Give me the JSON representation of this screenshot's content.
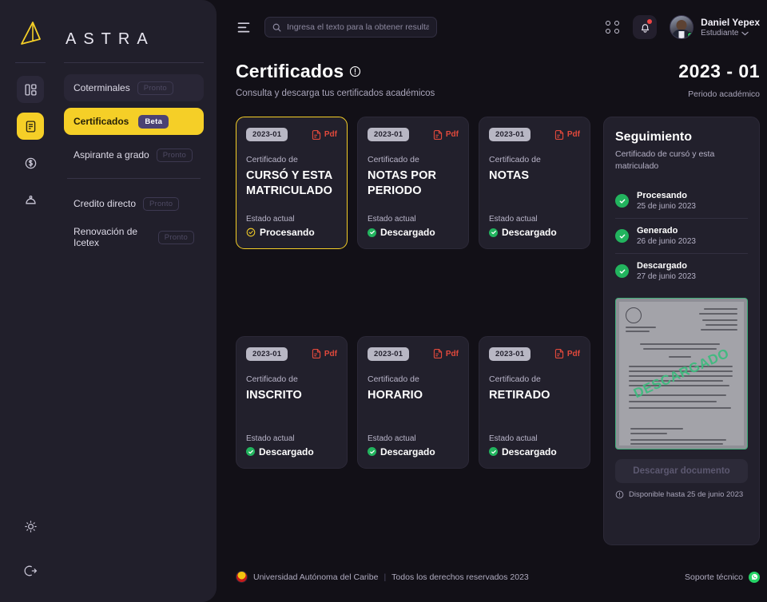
{
  "brand": {
    "word": "ASTRA",
    "logo_icon": "astra-triangle-logo"
  },
  "rail": {
    "items": [
      {
        "icon": "dashboard-layout-icon",
        "state": "panel"
      },
      {
        "icon": "document-certificate-icon",
        "state": "active"
      },
      {
        "icon": "dollar-coin-icon",
        "state": "idle"
      },
      {
        "icon": "graduation-cap-icon",
        "state": "idle"
      }
    ],
    "bottom": [
      {
        "icon": "sun-theme-icon"
      },
      {
        "icon": "logout-icon"
      }
    ]
  },
  "sidebar": {
    "items": [
      {
        "label": "Coterminales",
        "badge": "Pronto",
        "badge_type": "soon",
        "style": "soft"
      },
      {
        "label": "Certificados",
        "badge": "Beta",
        "badge_type": "beta",
        "style": "active"
      },
      {
        "label": "Aspirante a grado",
        "badge": "Pronto",
        "badge_type": "soon",
        "style": "plain"
      },
      {
        "label": "Credito directo",
        "badge": "Pronto",
        "badge_type": "soon",
        "style": "plain"
      },
      {
        "label": "Renovación de Icetex",
        "badge": "Pronto",
        "badge_type": "soon",
        "style": "plain"
      }
    ]
  },
  "topbar": {
    "menu_icon": "hamburger-menu-icon",
    "search": {
      "placeholder": "Ingresa el texto para la obtener resultados",
      "value": "",
      "icon": "search-icon"
    },
    "apps_icon": "grid-apps-icon",
    "bell_icon": "notification-bell-icon",
    "user": {
      "name": "Daniel Yepex",
      "role": "Estudiante",
      "chevron": "chevron-down-icon",
      "avatar": "user-avatar"
    }
  },
  "page": {
    "title": "Certificados",
    "title_info_icon": "info-circle-icon",
    "subtitle": "Consulta y descarga tus certificados académicos",
    "period_value": "2023 - 01",
    "period_label": "Periodo académico"
  },
  "cards": [
    {
      "period": "2023-01",
      "format": "Pdf",
      "kicker": "Certificado de",
      "name": "CURSÓ Y ESTA MATRICULADO",
      "state_label": "Estado actual",
      "state": "Procesando",
      "state_type": "pending",
      "selected": true
    },
    {
      "period": "2023-01",
      "format": "Pdf",
      "kicker": "Certificado de",
      "name": "NOTAS POR PERIODO",
      "state_label": "Estado actual",
      "state": "Descargado",
      "state_type": "ok",
      "selected": false
    },
    {
      "period": "2023-01",
      "format": "Pdf",
      "kicker": "Certificado de",
      "name": "NOTAS",
      "state_label": "Estado actual",
      "state": "Descargado",
      "state_type": "ok",
      "selected": false
    },
    {
      "period": "2023-01",
      "format": "Pdf",
      "kicker": "Certificado de",
      "name": "INSCRITO",
      "state_label": "Estado actual",
      "state": "Descargado",
      "state_type": "ok",
      "selected": false
    },
    {
      "period": "2023-01",
      "format": "Pdf",
      "kicker": "Certificado de",
      "name": "HORARIO",
      "state_label": "Estado actual",
      "state": "Descargado",
      "state_type": "ok",
      "selected": false
    },
    {
      "period": "2023-01",
      "format": "Pdf",
      "kicker": "Certificado de",
      "name": "RETIRADO",
      "state_label": "Estado actual",
      "state": "Descargado",
      "state_type": "ok",
      "selected": false
    }
  ],
  "tracking": {
    "title": "Seguimiento",
    "subtitle": "Certificado de cursó y esta matriculado",
    "steps": [
      {
        "name": "Procesando",
        "date": "25 de junio 2023",
        "icon": "check-circle-icon"
      },
      {
        "name": "Generado",
        "date": "26 de junio 2023",
        "icon": "check-circle-icon"
      },
      {
        "name": "Descargado",
        "date": "27 de junio 2023",
        "icon": "check-circle-icon"
      }
    ],
    "preview_stamp": "DESCARGADO",
    "download_label": "Descargar documento",
    "availability_icon": "info-circle-icon",
    "availability": "Disponible hasta 25 de junio 2023"
  },
  "footer": {
    "logo_icon": "universidad-autonoma-del-caribe-logo",
    "university": "Universidad Autónoma del Caribe",
    "rights": "Todos los derechos reservados  2023",
    "support": "Soporte técnico",
    "support_icon": "whatsapp-icon"
  },
  "colors": {
    "accent": "#f5cf27",
    "background": "#121017",
    "surface": "#22202c",
    "sidebar": "#211f2b",
    "success": "#22b45e",
    "pdf_red": "#e0493c",
    "beta_purple": "#4b4274"
  }
}
